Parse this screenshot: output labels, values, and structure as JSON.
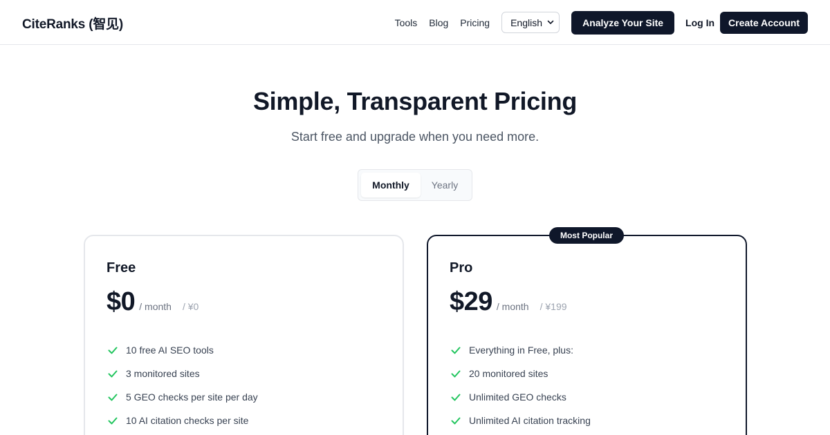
{
  "header": {
    "brand": "CiteRanks (智见)",
    "nav": [
      "Tools",
      "Blog",
      "Pricing"
    ],
    "language": "English",
    "analyze_label": "Analyze Your Site",
    "login_label": "Log In",
    "create_label": "Create Account"
  },
  "hero": {
    "title": "Simple, Transparent Pricing",
    "subtitle": "Start free and upgrade when you need more."
  },
  "billing_toggle": {
    "monthly": "Monthly",
    "yearly": "Yearly",
    "selected": "Monthly"
  },
  "plans": [
    {
      "name": "Free",
      "price": "$0",
      "period": "/ month",
      "cny": "/ ¥0",
      "features": [
        "10 free AI SEO tools",
        "3 monitored sites",
        "5 GEO checks per site per day",
        "10 AI citation checks per site"
      ]
    },
    {
      "name": "Pro",
      "badge": "Most Popular",
      "price": "$29",
      "period": "/ month",
      "cny": "/ ¥199",
      "features": [
        "Everything in Free, plus:",
        "20 monitored sites",
        "Unlimited GEO checks",
        "Unlimited AI citation tracking"
      ]
    }
  ],
  "colors": {
    "primary": "#0f172a",
    "check": "#22c55e",
    "muted": "#6b7280",
    "border": "#e5e7eb"
  }
}
